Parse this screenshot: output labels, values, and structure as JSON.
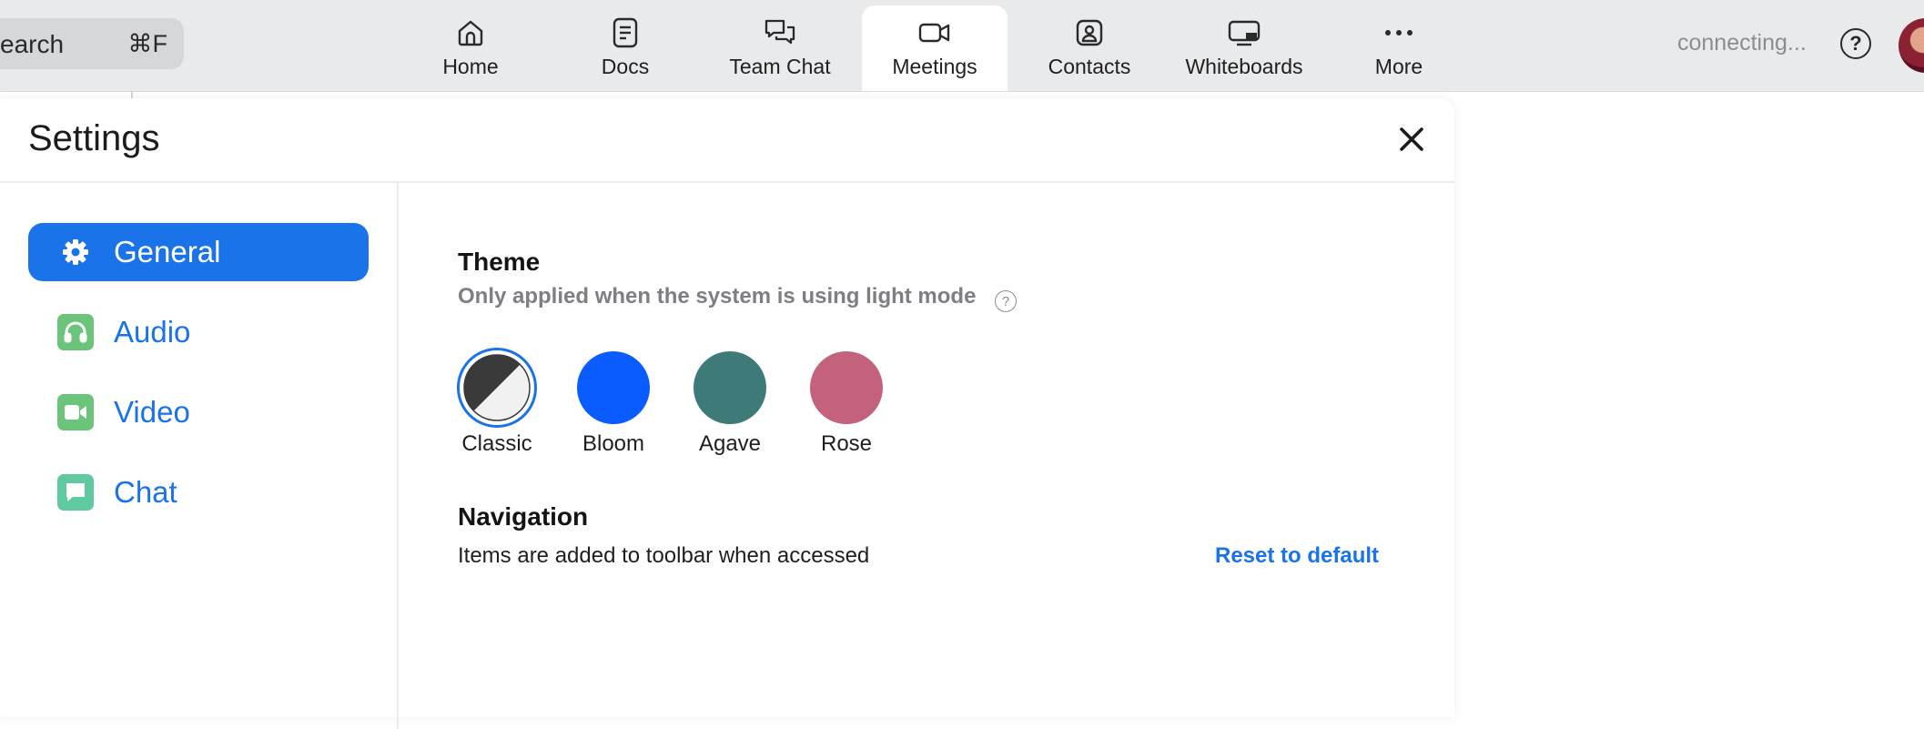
{
  "topbar": {
    "search": {
      "label": "earch",
      "shortcut": "⌘F"
    },
    "tabs": [
      {
        "label": "Home",
        "icon": "home-icon",
        "active": false
      },
      {
        "label": "Docs",
        "icon": "docs-icon",
        "active": false
      },
      {
        "label": "Team Chat",
        "icon": "team-chat-icon",
        "active": false
      },
      {
        "label": "Meetings",
        "icon": "meetings-icon",
        "active": true
      },
      {
        "label": "Contacts",
        "icon": "contacts-icon",
        "active": false
      },
      {
        "label": "Whiteboards",
        "icon": "whiteboards-icon",
        "active": false
      },
      {
        "label": "More",
        "icon": "more-icon",
        "active": false
      }
    ],
    "status": "connecting...",
    "help_glyph": "?"
  },
  "settings": {
    "title": "Settings",
    "sidebar": [
      {
        "label": "General",
        "icon": "gear-icon",
        "active": true,
        "icon_color": "#ffffff"
      },
      {
        "label": "Audio",
        "icon": "headphones-icon",
        "active": false,
        "icon_color": "#6cc47b"
      },
      {
        "label": "Video",
        "icon": "video-camera-icon",
        "active": false,
        "icon_color": "#6cc47b"
      },
      {
        "label": "Chat",
        "icon": "chat-bubble-icon",
        "active": false,
        "icon_color": "#5fc9a0"
      }
    ],
    "theme": {
      "title": "Theme",
      "subtitle": "Only applied when the system is using light mode",
      "help_glyph": "?",
      "options": [
        {
          "label": "Classic",
          "color": "#3a3a3a",
          "selected": true
        },
        {
          "label": "Bloom",
          "color": "#0b5cff",
          "selected": false
        },
        {
          "label": "Agave",
          "color": "#3e7a77",
          "selected": false
        },
        {
          "label": "Rose",
          "color": "#c4617c",
          "selected": false
        }
      ]
    },
    "navigation": {
      "title": "Navigation",
      "description": "Items are added to toolbar when accessed",
      "reset_label": "Reset to default"
    }
  },
  "colors": {
    "accent": "#1a73e8",
    "topbar_bg": "#e9eaec"
  }
}
